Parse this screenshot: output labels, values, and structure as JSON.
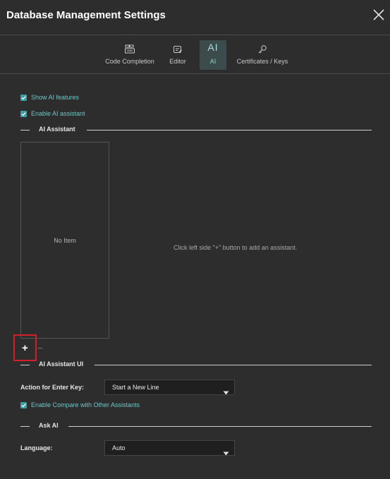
{
  "window": {
    "title": "Database Management Settings"
  },
  "tabs": [
    {
      "label": "Code Completion",
      "icon": "code-completion-icon"
    },
    {
      "label": "Editor",
      "icon": "editor-icon"
    },
    {
      "label": "AI",
      "icon": "ai-icon",
      "active": true,
      "glyph": "AI"
    },
    {
      "label": "Certificates / Keys",
      "icon": "key-icon"
    }
  ],
  "ai_features": {
    "show_ai_features": {
      "label": "Show AI features",
      "checked": true
    },
    "enable_ai_assistant": {
      "label": "Enable AI assistant",
      "checked": true
    }
  },
  "assistant_section": {
    "title": "AI Assistant",
    "empty_list_text": "No Item",
    "hint": "Click left side \"+\" button to add an assistant.",
    "add_label": "+",
    "remove_label": "−"
  },
  "assistant_ui_section": {
    "title": "AI Assistant UI",
    "enter_key_label": "Action for Enter Key:",
    "enter_key_value": "Start a New Line",
    "compare_checkbox": {
      "label": "Enable Compare with Other Assistants",
      "checked": true
    }
  },
  "ask_ai_section": {
    "title": "Ask AI",
    "language_label": "Language:",
    "language_value": "Auto"
  },
  "colors": {
    "background": "#2d2d2d",
    "accent": "#3aa0a8",
    "highlight_box": "#d41f2a"
  }
}
